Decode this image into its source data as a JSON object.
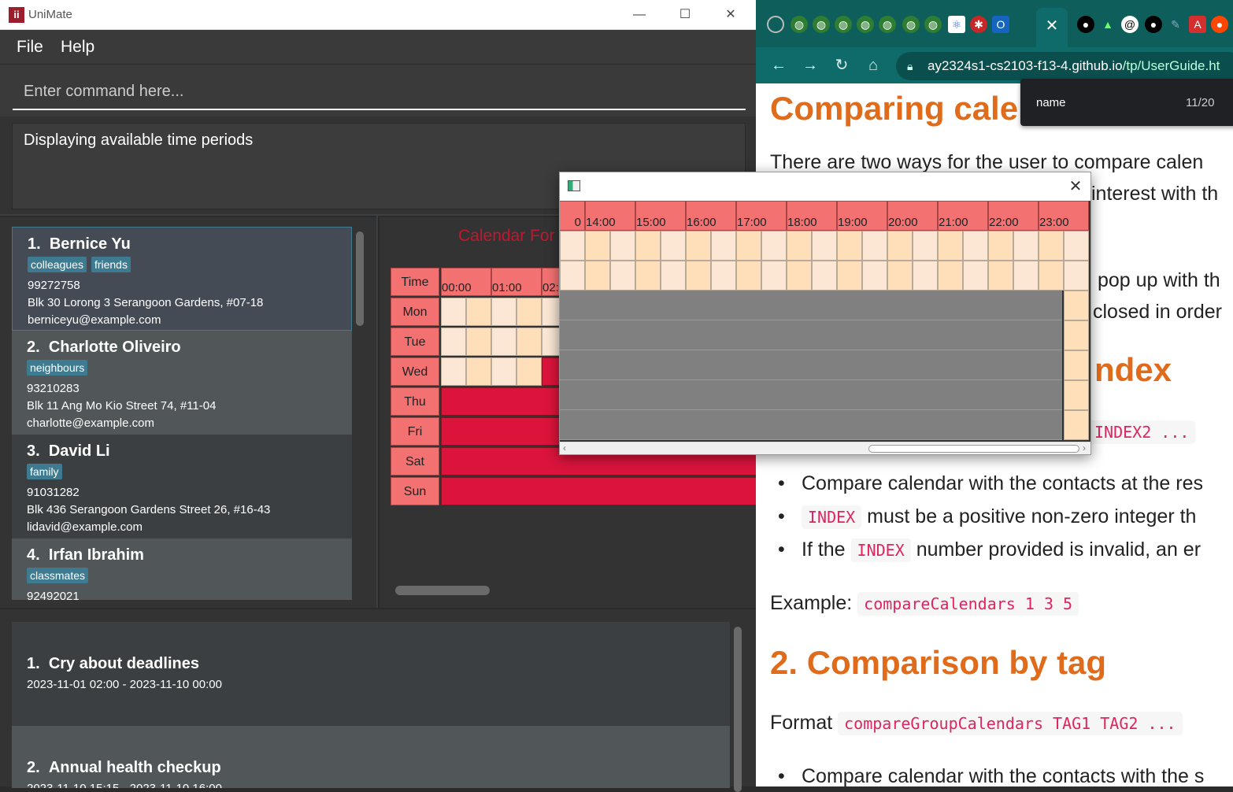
{
  "unimate": {
    "title": "UniMate",
    "controls": {
      "minimize": "—",
      "maximize": "☐",
      "close": "✕"
    },
    "menu": [
      "File",
      "Help"
    ],
    "command_placeholder": "Enter command here...",
    "result": "Displaying available time periods",
    "persons": [
      {
        "index": "1.",
        "name": "Bernice Yu",
        "tags": [
          "colleagues",
          "friends"
        ],
        "phone": "99272758",
        "address": "Blk 30 Lorong 3 Serangoon Gardens, #07-18",
        "email": "berniceyu@example.com"
      },
      {
        "index": "2.",
        "name": "Charlotte Oliveiro",
        "tags": [
          "neighbours"
        ],
        "phone": "93210283",
        "address": "Blk 11 Ang Mo Kio Street 74, #11-04",
        "email": "charlotte@example.com"
      },
      {
        "index": "3.",
        "name": "David Li",
        "tags": [
          "family"
        ],
        "phone": "91031282",
        "address": "Blk 436 Serangoon Gardens Street 26, #16-43",
        "email": "lidavid@example.com"
      },
      {
        "index": "4.",
        "name": "Irfan Ibrahim",
        "tags": [
          "classmates"
        ],
        "phone": "92492021",
        "address": "",
        "email": ""
      }
    ],
    "calendar": {
      "title": "Calendar For",
      "time_label": "Time",
      "days": [
        "Mon",
        "Tue",
        "Wed",
        "Thu",
        "Fri",
        "Sat",
        "Sun"
      ],
      "times": [
        "00:00",
        "01:00",
        "02:0"
      ]
    },
    "events": [
      {
        "index": "1.",
        "name": "Cry about deadlines",
        "time": "2023-11-01 02:00 - 2023-11-10 00:00"
      },
      {
        "index": "2.",
        "name": "Annual health checkup",
        "time": "2023-11-10 15:15 - 2023-11-10 16:00"
      }
    ]
  },
  "browser": {
    "url_host": "ay2324s1-cs2103-f13-4.github.io",
    "url_path": "/tp/UserGuide.ht",
    "find": {
      "query": "name",
      "count": "11/20"
    },
    "doc": {
      "h_compare": "Comparing calen",
      "intro_1": "There are two ways for the user to compare calen",
      "intro_2": "interest with th",
      "popup_1": "pop up with th",
      "popup_2": "closed in order",
      "h_index": "ndex",
      "format_index_code": "INDEX2 ...",
      "bullet_1": "Compare calendar with the contacts at the res",
      "bullet_2_code": "INDEX",
      "bullet_2_text": "must be a positive non-zero integer th",
      "bullet_3_pre": "If the",
      "bullet_3_code": "INDEX",
      "bullet_3_post": "number provided is invalid, an er",
      "example_label": "Example:",
      "example_code": "compareCalendars 1 3 5",
      "h_tag": "2. Comparison by tag",
      "format_label": "Format",
      "format_code": "compareGroupCalendars TAG1 TAG2 ...",
      "bullet_4": "Compare calendar with the contacts with the s"
    }
  },
  "popup": {
    "close": "✕",
    "first_partial": "0",
    "times": [
      "14:00",
      "15:00",
      "16:00",
      "17:00",
      "18:00",
      "19:00",
      "20:00",
      "21:00",
      "22:00",
      "23:00"
    ]
  },
  "colors": {
    "busy": "#dc143c",
    "free_a": "#fbe7d4",
    "free_b": "#ffdfba",
    "header": "#f47171",
    "heading": "#e06c1b"
  }
}
